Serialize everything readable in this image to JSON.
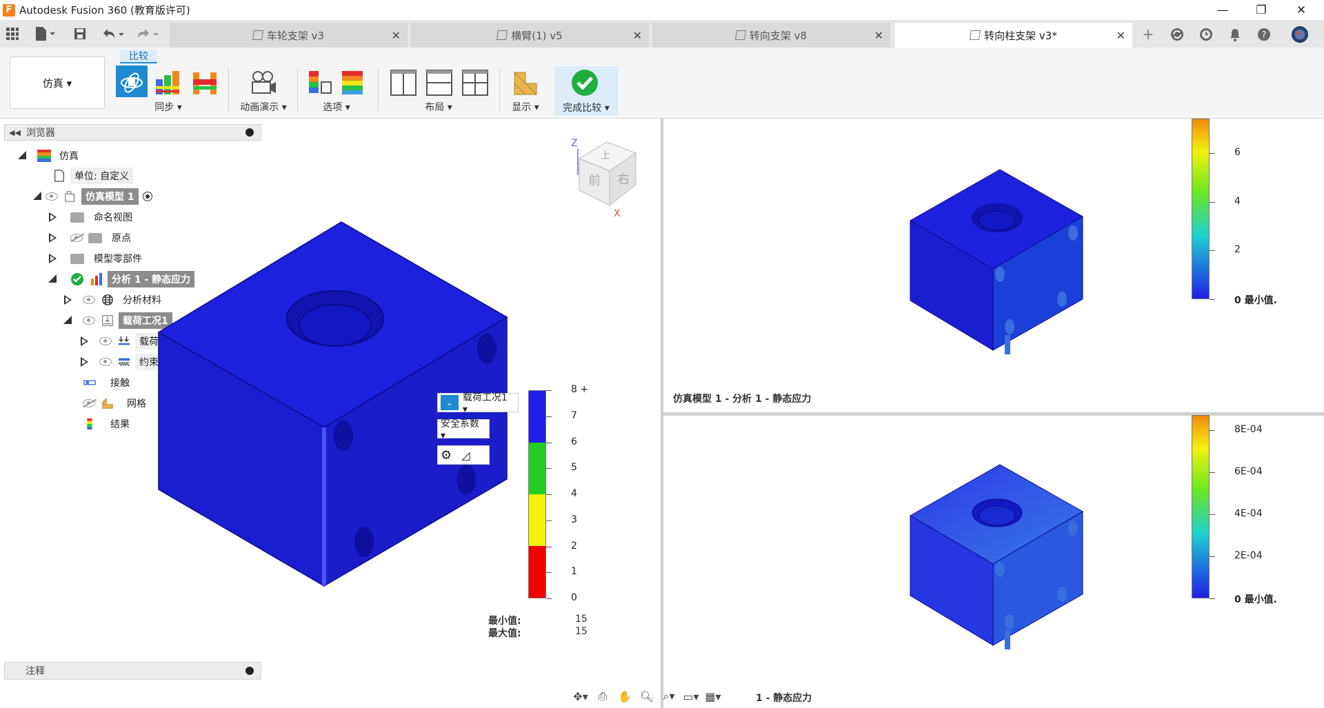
{
  "window": {
    "title": "Autodesk Fusion 360 (教育版许可)",
    "minimize": "—",
    "restore": "❐",
    "close": "✕"
  },
  "tabs": [
    {
      "label": "车轮支架 v3",
      "active": false
    },
    {
      "label": "横臂(1) v5",
      "active": false
    },
    {
      "label": "转向支架 v8",
      "active": false
    },
    {
      "label": "转向柱支架 v3*",
      "active": true
    }
  ],
  "ribbon": {
    "workspace": "仿真 ▾",
    "compare_tag": "比较",
    "groups": {
      "sync": "同步 ▾",
      "animation": "动画演示 ▾",
      "options": "选项 ▾",
      "layout": "布局 ▾",
      "display": "显示 ▾",
      "finish": "完成比较 ▾"
    }
  },
  "browser": {
    "title": "浏览器",
    "items": [
      {
        "label": "仿真"
      },
      {
        "label": "单位: 自定义"
      },
      {
        "label": "仿真模型 1"
      },
      {
        "label": "命名视图"
      },
      {
        "label": "原点"
      },
      {
        "label": "模型零部件"
      },
      {
        "label": "分析 1 - 静态应力"
      },
      {
        "label": "分析材料"
      },
      {
        "label": "载荷工况1"
      },
      {
        "label": "载荷"
      },
      {
        "label": "约束"
      },
      {
        "label": "接触"
      },
      {
        "label": "网格"
      },
      {
        "label": "结果"
      }
    ]
  },
  "notes": {
    "title": "注释"
  },
  "viewcube": {
    "top": "上",
    "front": "前",
    "right": "右",
    "z": "Z",
    "x": "X"
  },
  "left_view": {
    "loadcase_label": "载荷工况1 ▾",
    "result_type": "安全系数 ▾",
    "legend_ticks": [
      "8 +",
      "7",
      "6",
      "5",
      "4",
      "3",
      "2",
      "1",
      "0"
    ],
    "legend_colors": {
      "blue": "#1f1fe8",
      "green": "#22cc22",
      "yellow": "#f2f20a",
      "red": "#f00000"
    },
    "min_label": "最小值:",
    "min_value": "15",
    "max_label": "最大值:",
    "max_value": "15"
  },
  "top_right": {
    "legend_ticks": [
      "6",
      "4",
      "2",
      "0 最小值."
    ],
    "caption": "仿真模型 1 - 分析 1 - 静态应力"
  },
  "bottom_right": {
    "legend_ticks": [
      "8E-04",
      "6E-04",
      "4E-04",
      "2E-04",
      "0 最小值."
    ],
    "caption": "1 - 静态应力"
  }
}
